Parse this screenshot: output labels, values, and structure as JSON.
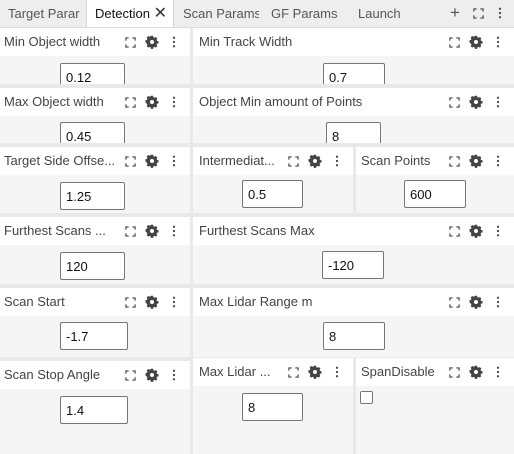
{
  "tabs": [
    {
      "label": "Target Parar",
      "active": false
    },
    {
      "label": "Detection",
      "active": true
    },
    {
      "label": "Scan Params",
      "active": false
    },
    {
      "label": "GF Params",
      "active": false
    },
    {
      "label": "Launch",
      "active": false
    }
  ],
  "tab_close_glyph": "✕",
  "tabbar_actions": {
    "add": "+"
  },
  "panels": {
    "min_object_width": {
      "title": "Min Object width",
      "value": "0.12"
    },
    "min_track_width": {
      "title": "Min Track Width",
      "value": "0.7"
    },
    "max_object_width": {
      "title": "Max Object width",
      "value": "0.45"
    },
    "object_min_points": {
      "title": "Object Min amount of Points",
      "value": "8"
    },
    "target_side_offset": {
      "title": "Target Side Offse...",
      "value": "1.25"
    },
    "intermediate": {
      "title": "Intermediat...",
      "value": "0.5"
    },
    "scan_points": {
      "title": "Scan Points",
      "value": "600"
    },
    "furthest_scans_min": {
      "title": "Furthest Scans ...",
      "value": "120"
    },
    "furthest_scans_max": {
      "title": "Furthest Scans Max",
      "value": "-120"
    },
    "scan_start": {
      "title": "Scan Start",
      "value": "-1.7"
    },
    "max_lidar_range": {
      "title": "Max Lidar Range m",
      "value": "8"
    },
    "scan_stop_angle": {
      "title": "Scan Stop Angle",
      "value": "1.4"
    },
    "max_lidar_short": {
      "title": "Max Lidar ...",
      "value": "8"
    },
    "span_disable": {
      "title": "SpanDisable",
      "checked": false
    }
  },
  "icons": {
    "maximize": "maximize-icon",
    "settings": "gear-icon",
    "menu": "kebab-menu-icon"
  }
}
